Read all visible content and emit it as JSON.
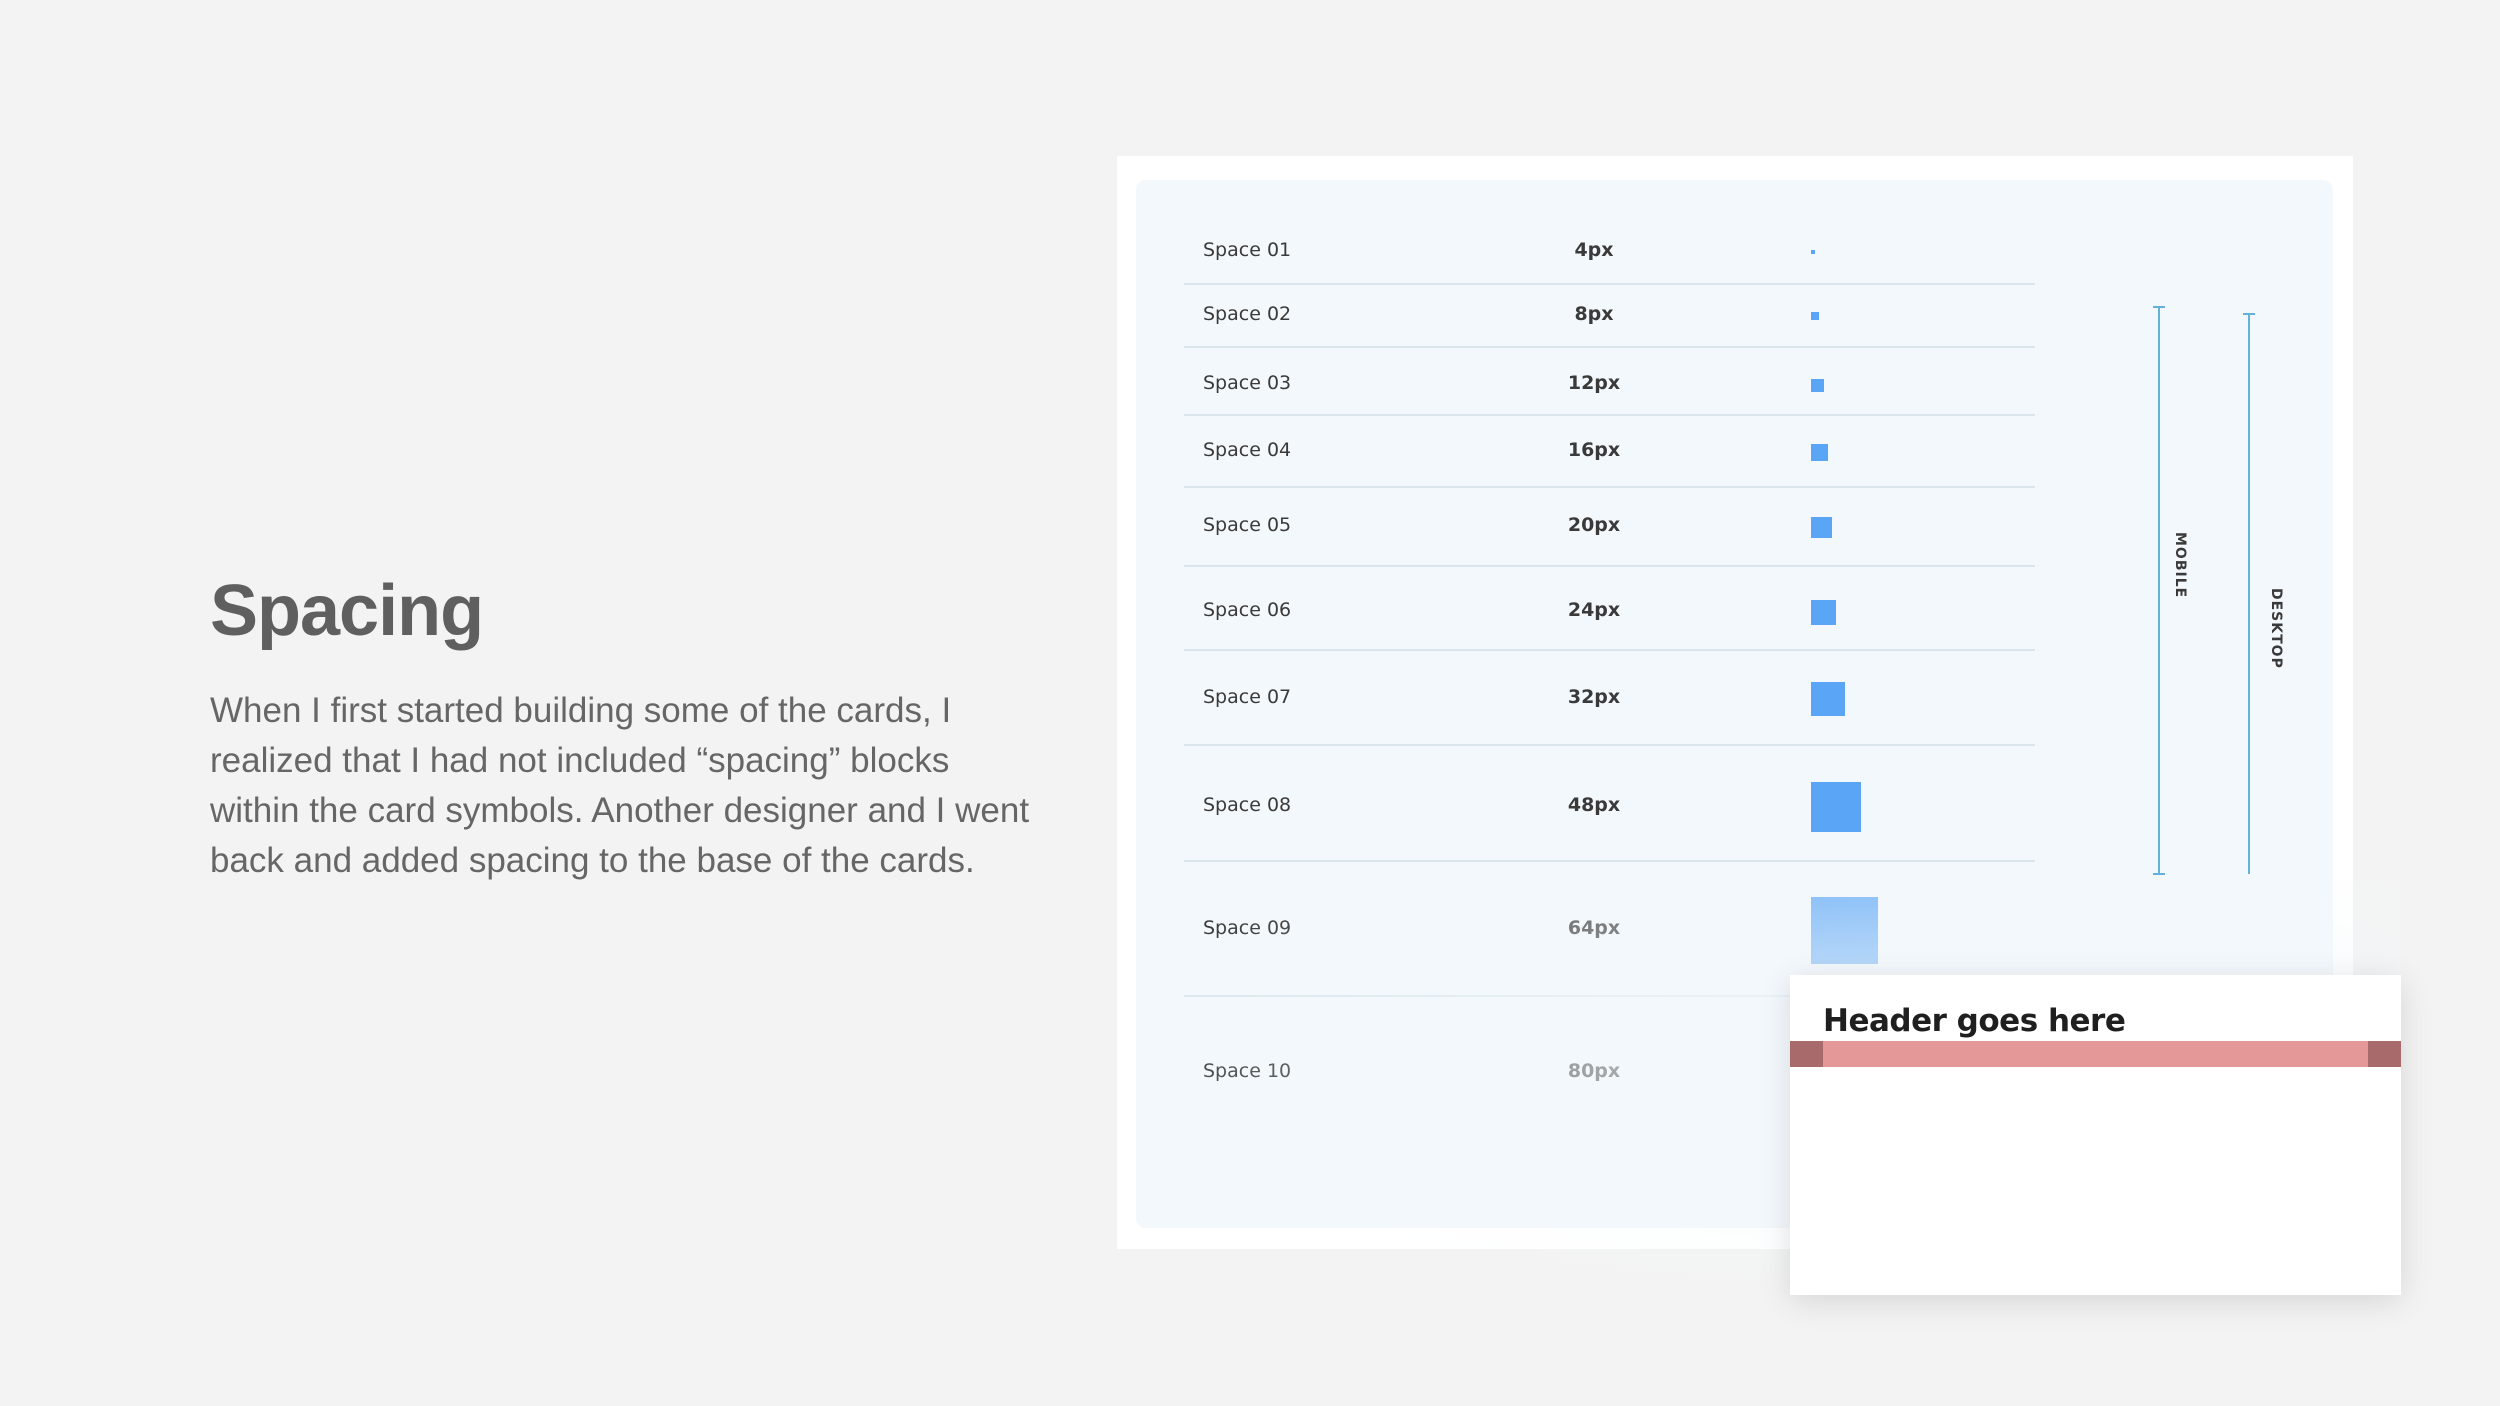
{
  "page": {
    "title": "Spacing",
    "description": "When I first started building some of the cards, I realized that I had not included “spacing” blocks within the card symbols. Another designer and I went back and added spacing to the base of the cards."
  },
  "spacing_table": {
    "rows": [
      {
        "name": "Space 01",
        "value": "4px",
        "size": 4
      },
      {
        "name": "Space 02",
        "value": "8px",
        "size": 8
      },
      {
        "name": "Space 03",
        "value": "12px",
        "size": 12
      },
      {
        "name": "Space 04",
        "value": "16px",
        "size": 16
      },
      {
        "name": "Space 05",
        "value": "20px",
        "size": 20
      },
      {
        "name": "Space 06",
        "value": "24px",
        "size": 24
      },
      {
        "name": "Space 07",
        "value": "32px",
        "size": 32
      },
      {
        "name": "Space 08",
        "value": "48px",
        "size": 48
      },
      {
        "name": "Space 09",
        "value": "64px",
        "size": 64
      },
      {
        "name": "Space 10",
        "value": "80px",
        "size": 80
      }
    ],
    "mobile_label": "MOBILE",
    "desktop_label": "DESKTOP",
    "swatch_color": "#5aa5f5",
    "bracket_color": "#63b0d8"
  },
  "card": {
    "header": "Header goes here",
    "bar_color": "#e59898",
    "bar_edge_color": "#a86a6b"
  }
}
